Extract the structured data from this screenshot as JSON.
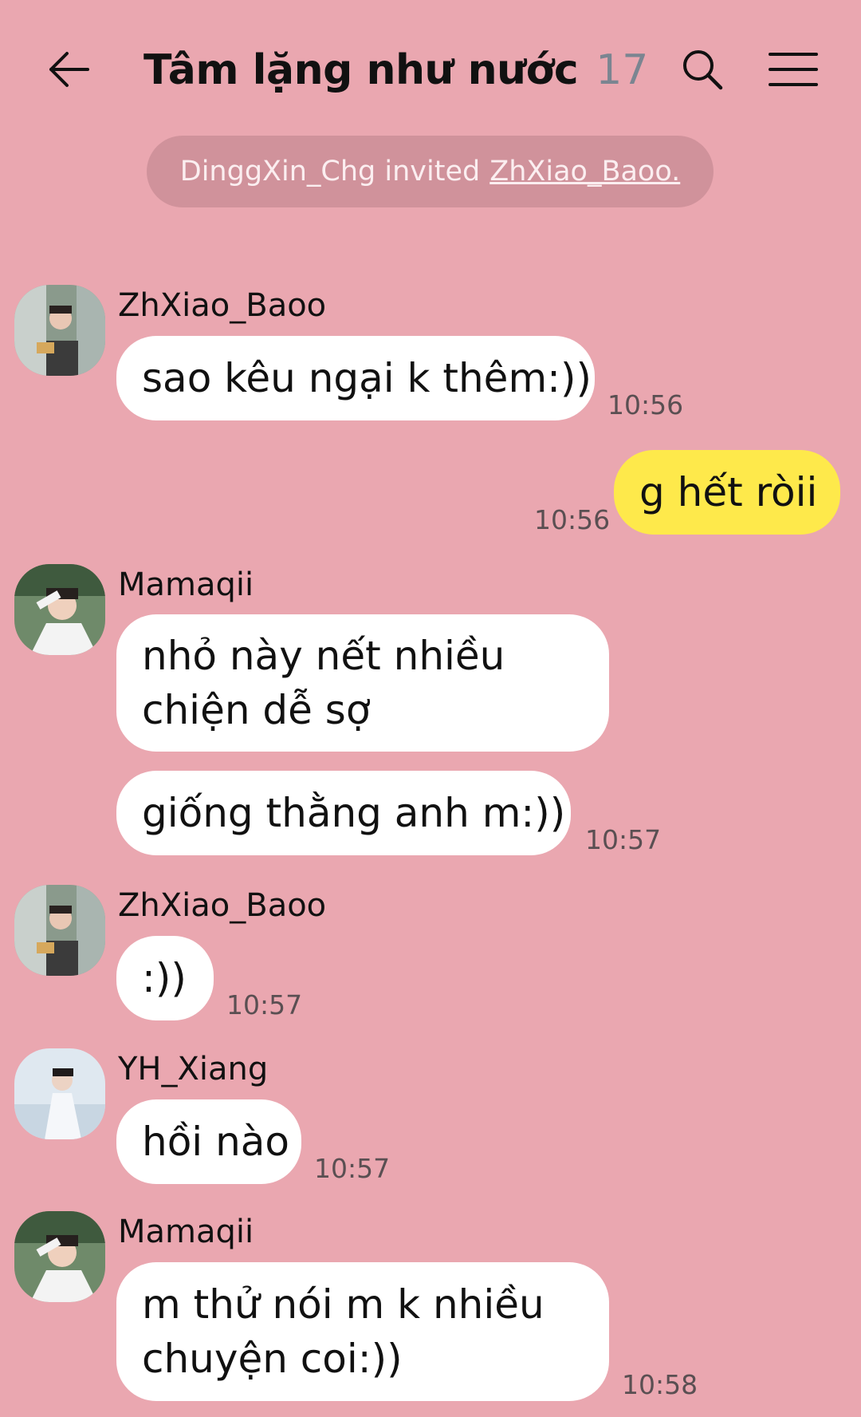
{
  "header": {
    "title": "Tâm lặng như nước",
    "member_count": "17",
    "back_icon": "arrow-left-icon",
    "search_icon": "search-icon",
    "menu_icon": "hamburger-menu-icon"
  },
  "notice": {
    "text": "DinggXin_Chg invited",
    "link": "ZhXiao_Baoo."
  },
  "messages": [
    {
      "sender": "ZhXiao_Baoo",
      "text": "sao kêu ngại k thêm:))",
      "time": "10:56"
    },
    {
      "sender": "me",
      "text": "g hết ròii",
      "time": "10:56"
    },
    {
      "sender": "Mamaqii",
      "line1": "nhỏ này nết nhiều",
      "line2": "chiện dễ sợ",
      "text2": "giống thằng anh m:))",
      "time": "10:57"
    },
    {
      "sender": "ZhXiao_Baoo",
      "text": ":))",
      "time": "10:57"
    },
    {
      "sender": "YH_Xiang",
      "text": "hồi nào",
      "time": "10:57"
    },
    {
      "sender": "Mamaqii",
      "line1": "m thử nói m k nhiều",
      "line2": "chuyện coi:))",
      "time": "10:58"
    }
  ],
  "colors": {
    "background": "#eaa7b0",
    "my_bubble": "#fee94b",
    "other_bubble": "#ffffff"
  }
}
